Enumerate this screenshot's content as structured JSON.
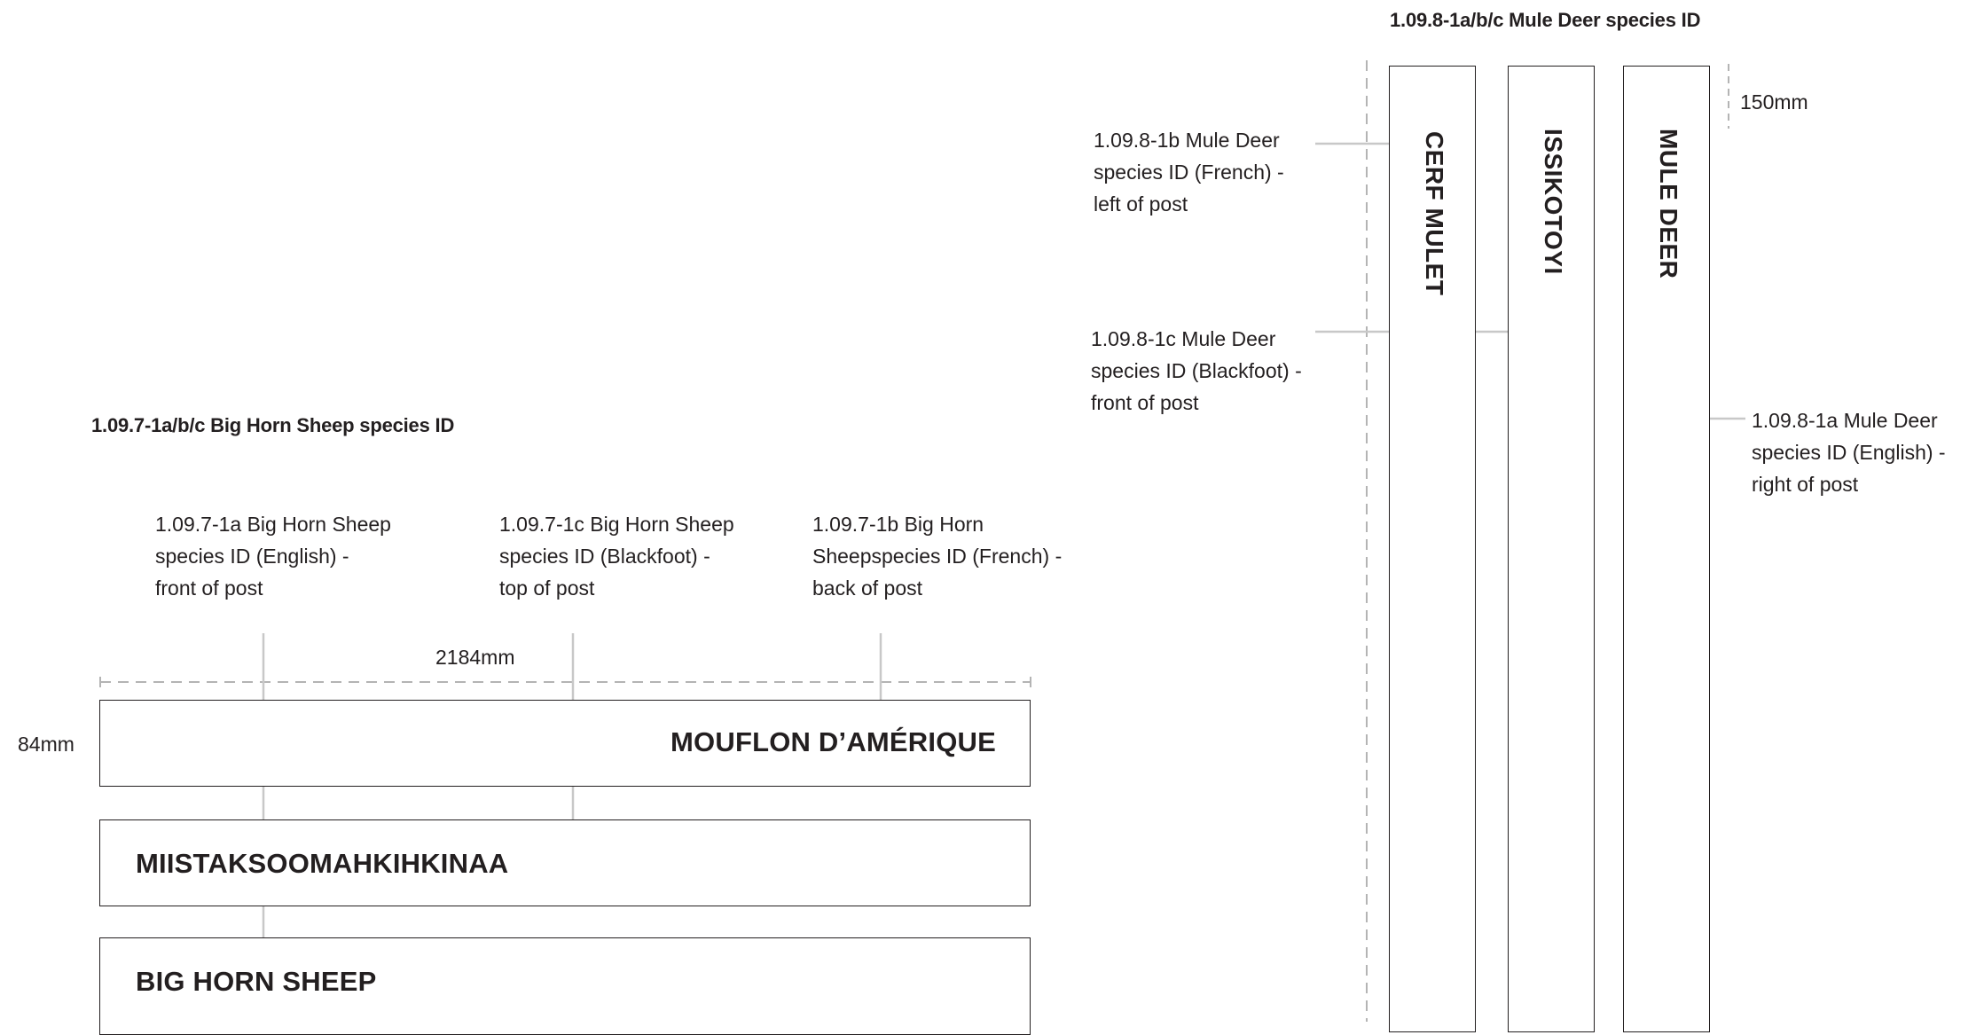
{
  "sheep": {
    "heading": "1.09.7-1a/b/c Big Horn Sheep species ID",
    "notes": {
      "english": [
        "1.09.7-1a Big Horn Sheep",
        "species ID (English)  -",
        "front of post"
      ],
      "blackfoot": [
        "1.09.7-1c Big Horn Sheep",
        "species ID (Blackfoot)  -",
        "top of post"
      ],
      "french": [
        "1.09.7-1b Big Horn",
        "Sheepspecies ID (French)  -",
        "back of post"
      ]
    },
    "width_dim": "2184mm",
    "height_dim": "84mm",
    "signs": {
      "french": "MOUFLON D’AMÉRIQUE",
      "blackfoot": "MIISTAKSOOMAHKIHKINAA",
      "english": "BIG HORN SHEEP"
    }
  },
  "deer": {
    "heading": "1.09.8-1a/b/c Mule Deer species ID",
    "notes": {
      "french": [
        "1.09.8-1b Mule Deer",
        "species ID (French)  -",
        " left of post"
      ],
      "blackfoot": [
        "1.09.8-1c Mule Deer",
        "species ID (Blackfoot) -",
        "front of post"
      ],
      "english": [
        "1.09.8-1a Mule Deer",
        "species ID (English)  -",
        "right of post"
      ]
    },
    "width_dim": "150mm",
    "posts": {
      "french": "CERF MULET",
      "blackfoot": "ISSIKOTOYI",
      "english": "MULE DEER"
    }
  },
  "colors": {
    "ink": "#231f20",
    "leader": "#c8c8c8",
    "dashed": "#b4b4b4"
  }
}
